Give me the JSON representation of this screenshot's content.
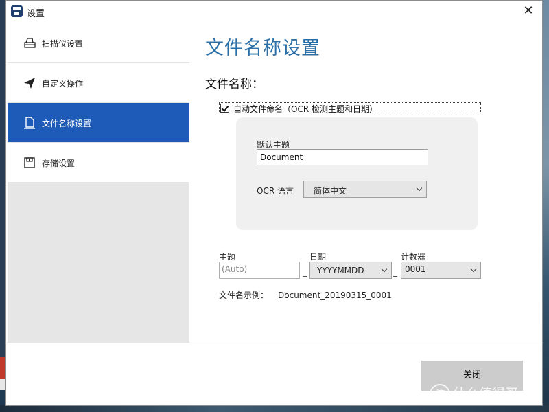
{
  "window": {
    "title": "设置",
    "close_glyph": "✕"
  },
  "sidebar": {
    "items": [
      {
        "label": "扫描仪设置",
        "icon": "scanner-icon",
        "active": false
      },
      {
        "label": "自定义操作",
        "icon": "send-icon",
        "active": false
      },
      {
        "label": "文件名称设置",
        "icon": "document-icon",
        "active": true
      },
      {
        "label": "存储设置",
        "icon": "save-icon",
        "active": false
      }
    ]
  },
  "main": {
    "page_title": "文件名称设置",
    "section_title": "文件名称：",
    "auto_name": {
      "checked": true,
      "label": "自动文件命名（OCR 检测主题和日期）"
    },
    "default_subject": {
      "label": "默认主题",
      "value": "Document"
    },
    "ocr_language": {
      "label": "OCR 语言",
      "value": "简体中文"
    },
    "fields": {
      "subject": {
        "label": "主题",
        "placeholder": "(Auto)"
      },
      "date": {
        "label": "日期",
        "value": "YYYYMMDD"
      },
      "counter": {
        "label": "计数器",
        "value": "0001"
      },
      "separator": "_"
    },
    "example": {
      "label": "文件名示例：",
      "value": "Document_20190315_0001"
    }
  },
  "footer": {
    "close_label": "关闭"
  },
  "watermark": {
    "badge": "值",
    "text": "什么值得买"
  },
  "colors": {
    "accent": "#1e5bb8",
    "title": "#2c6fa6"
  }
}
